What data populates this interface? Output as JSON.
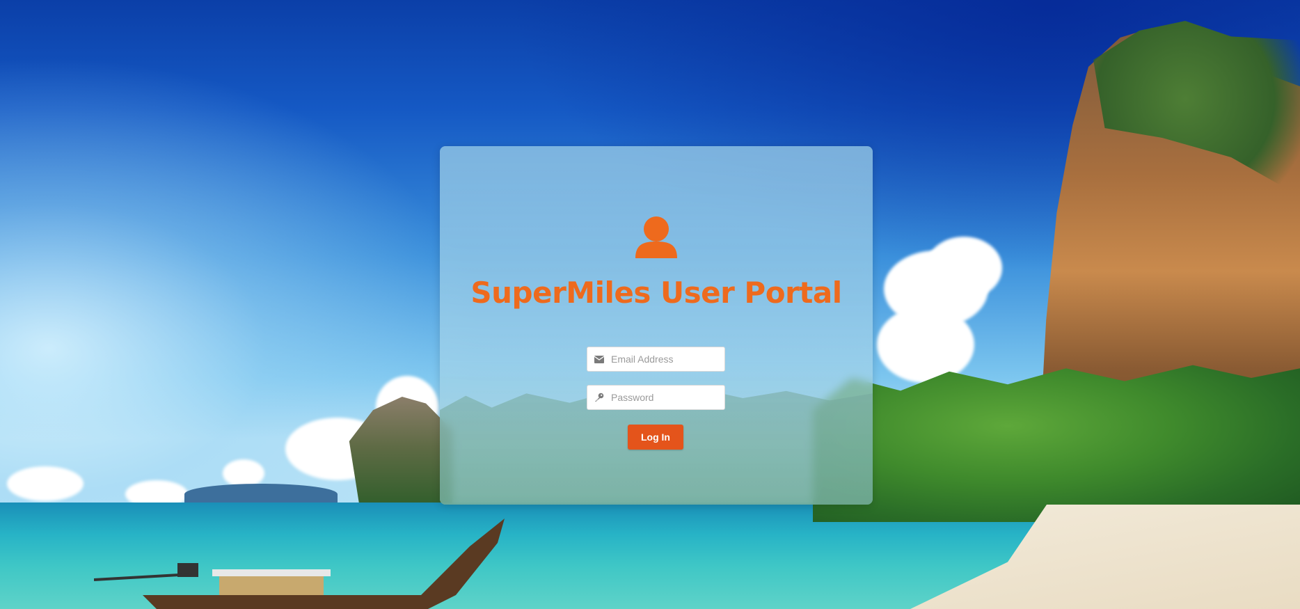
{
  "background": {
    "description_icon": "tropical-beach-background",
    "sky_color": "#1559c4",
    "sea_color": "#27b3c6"
  },
  "login_card": {
    "icon": "user-icon",
    "title": "SuperMiles User Portal",
    "email": {
      "icon": "envelope-icon",
      "placeholder": "Email Address",
      "value": ""
    },
    "password": {
      "icon": "key-icon",
      "placeholder": "Password",
      "value": ""
    },
    "login_label": "Log In"
  },
  "colors": {
    "accent": "#ee6a1d",
    "button": "#e4541b",
    "card_background": "rgba(170,215,235,0.62)"
  }
}
